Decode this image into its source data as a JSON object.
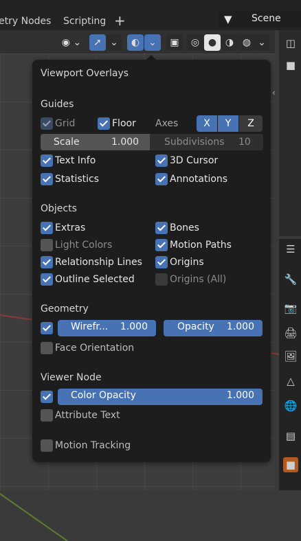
{
  "workspace_tabs": [
    "etry Nodes",
    "Scripting"
  ],
  "add_tab": "+",
  "scene": {
    "icon": "scene-icon",
    "name": "Scene"
  },
  "header_icons": [
    "visibility-icon",
    "gizmo-icon",
    "overlays-icon",
    "xray-icon",
    "wireframe-shading-icon",
    "solid-shading-icon",
    "material-preview-icon",
    "rendered-icon"
  ],
  "popover": {
    "title": "Viewport Overlays",
    "guides": {
      "heading": "Guides",
      "grid": "Grid",
      "floor": "Floor",
      "axes_label": "Axes",
      "axes": [
        "X",
        "Y",
        "Z"
      ],
      "scale_label": "Scale",
      "scale_value": "1.000",
      "subdivisions_label": "Subdivisions",
      "subdivisions_value": "10",
      "text_info": "Text Info",
      "cursor_3d": "3D Cursor",
      "statistics": "Statistics",
      "annotations": "Annotations"
    },
    "objects": {
      "heading": "Objects",
      "extras": "Extras",
      "bones": "Bones",
      "light_colors": "Light Colors",
      "motion_paths": "Motion Paths",
      "relationship_lines": "Relationship Lines",
      "origins": "Origins",
      "outline_selected": "Outline Selected",
      "origins_all": "Origins (All)"
    },
    "geometry": {
      "heading": "Geometry",
      "wireframe_label": "Wirefr...",
      "wireframe_value": "1.000",
      "opacity_label": "Opacity",
      "opacity_value": "1.000",
      "face_orientation": "Face Orientation"
    },
    "viewer_node": {
      "heading": "Viewer Node",
      "color_opacity_label": "Color Opacity",
      "color_opacity_value": "1.000",
      "attribute_text": "Attribute Text"
    },
    "motion_tracking": "Motion Tracking"
  },
  "colors": {
    "accent": "#4772b3",
    "popover_bg": "#1d1d1d"
  }
}
